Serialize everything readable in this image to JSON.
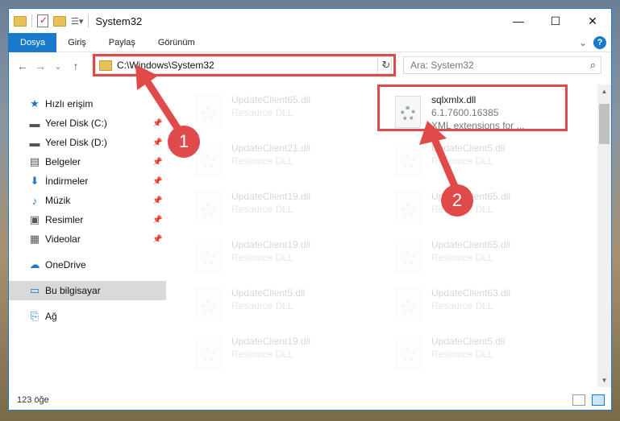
{
  "window": {
    "title": "System32",
    "quick_access_icons": [
      "folder-icon",
      "properties-icon",
      "new-folder-icon",
      "customize-icon"
    ],
    "controls": [
      "minimize-icon",
      "maximize-icon",
      "close-icon"
    ]
  },
  "ribbon": {
    "tabs": [
      "Dosya",
      "Giriş",
      "Paylaş",
      "Görünüm"
    ],
    "help_label": "?"
  },
  "navbar": {
    "back_icon": "←",
    "forward_icon": "→",
    "recent_icon": "⌄",
    "up_icon": "↑",
    "address": "C:\\Windows\\System32",
    "refresh_icon": "↻",
    "search_placeholder": "Ara: System32",
    "search_icon": "⌕"
  },
  "sidebar": {
    "items": [
      {
        "label": "Hızlı erişim",
        "icon": "star-icon",
        "glyph": "★",
        "pinned": false
      },
      {
        "label": "Yerel Disk (C:)",
        "icon": "drive-icon",
        "glyph": "▬",
        "pinned": true
      },
      {
        "label": "Yerel Disk (D:)",
        "icon": "drive-icon",
        "glyph": "▬",
        "pinned": true
      },
      {
        "label": "Belgeler",
        "icon": "documents-icon",
        "glyph": "▤",
        "pinned": true
      },
      {
        "label": "İndirmeler",
        "icon": "download-icon",
        "glyph": "⬇",
        "pinned": true
      },
      {
        "label": "Müzik",
        "icon": "music-icon",
        "glyph": "♪",
        "pinned": true
      },
      {
        "label": "Resimler",
        "icon": "pictures-icon",
        "glyph": "▣",
        "pinned": true
      },
      {
        "label": "Videolar",
        "icon": "videos-icon",
        "glyph": "▦",
        "pinned": true
      },
      {
        "label": "OneDrive",
        "icon": "cloud-icon",
        "glyph": "☁",
        "pinned": false
      },
      {
        "label": "Bu bilgisayar",
        "icon": "computer-icon",
        "glyph": "▭",
        "pinned": false,
        "selected": true
      },
      {
        "label": "Ağ",
        "icon": "network-icon",
        "glyph": "⎘",
        "pinned": false
      }
    ]
  },
  "files": [
    {
      "name": "UpdateClient65.dll",
      "type": "Resource DLL",
      "desc": "",
      "faded": true
    },
    {
      "name": "sqlxmlx.dll",
      "type": "6.1.7600.16385",
      "desc": "XML extensions for ...",
      "faded": false,
      "highlighted": true
    },
    {
      "name": "UpdateClient21.dll",
      "type": "Resource DLL",
      "desc": "",
      "faded": true
    },
    {
      "name": "UpdateClient5.dll",
      "type": "Resource DLL",
      "desc": "",
      "faded": true
    },
    {
      "name": "UpdateClient19.dll",
      "type": "Resource DLL",
      "desc": "",
      "faded": true
    },
    {
      "name": "UpdateClient65.dll",
      "type": "Resource DLL",
      "desc": "",
      "faded": true
    },
    {
      "name": "UpdateClient19.dll",
      "type": "Resource DLL",
      "desc": "",
      "faded": true
    },
    {
      "name": "UpdateClient65.dll",
      "type": "Resource DLL",
      "desc": "",
      "faded": true
    },
    {
      "name": "UpdateClient5.dll",
      "type": "Resource DLL",
      "desc": "",
      "faded": true
    },
    {
      "name": "UpdateClient63.dll",
      "type": "Resource DLL",
      "desc": "",
      "faded": true
    },
    {
      "name": "UpdateClient19.dll",
      "type": "Resource DLL",
      "desc": "",
      "faded": true
    },
    {
      "name": "UpdateClient5.dll",
      "type": "Resource DLL",
      "desc": "",
      "faded": true
    }
  ],
  "status": {
    "item_count": "123 öğe"
  },
  "annotations": {
    "badge_1": "1",
    "badge_2": "2",
    "color": "#e04a4a"
  },
  "colors": {
    "accent": "#1979ca",
    "highlight_box": "#e04a4a"
  }
}
